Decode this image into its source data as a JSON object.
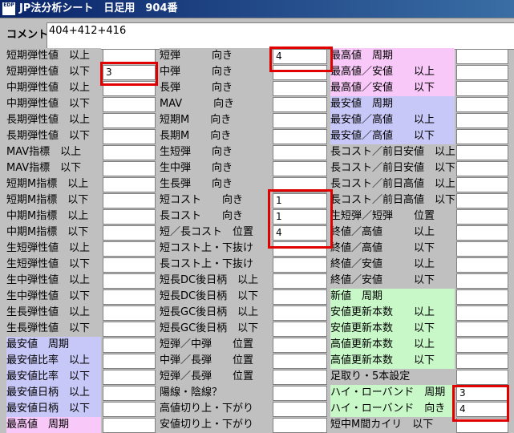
{
  "window": {
    "title": "JP法分析シート　日足用　904番",
    "icon_text": "EDP"
  },
  "comment": {
    "label": "コメント",
    "value": "404+412+416"
  },
  "col1": [
    {
      "label": "短期弾性値　以上",
      "bg": "#c0c0c0",
      "value": ""
    },
    {
      "label": "短期弾性値　以下",
      "bg": "#c0c0c0",
      "value": "3"
    },
    {
      "label": "中期弾性値　以上",
      "bg": "#c0c0c0",
      "value": ""
    },
    {
      "label": "中期弾性値　以下",
      "bg": "#c0c0c0",
      "value": ""
    },
    {
      "label": "長期弾性値　以上",
      "bg": "#c0c0c0",
      "value": ""
    },
    {
      "label": "長期弾性値　以下",
      "bg": "#c0c0c0",
      "value": ""
    },
    {
      "label": "MAV指標　以上",
      "bg": "#c0c0c0",
      "value": ""
    },
    {
      "label": "MAV指標　以下",
      "bg": "#c0c0c0",
      "value": ""
    },
    {
      "label": "短期M指標　以上",
      "bg": "#c0c0c0",
      "value": ""
    },
    {
      "label": "短期M指標　以下",
      "bg": "#c0c0c0",
      "value": ""
    },
    {
      "label": "中期M指標　以上",
      "bg": "#c0c0c0",
      "value": ""
    },
    {
      "label": "中期M指標　以下",
      "bg": "#c0c0c0",
      "value": ""
    },
    {
      "label": "生短弾性値　以上",
      "bg": "#c0c0c0",
      "value": ""
    },
    {
      "label": "生短弾性値　以下",
      "bg": "#c0c0c0",
      "value": ""
    },
    {
      "label": "生中弾性値　以上",
      "bg": "#c0c0c0",
      "value": ""
    },
    {
      "label": "生中弾性値　以下",
      "bg": "#c0c0c0",
      "value": ""
    },
    {
      "label": "生長弾性値　以上",
      "bg": "#c0c0c0",
      "value": ""
    },
    {
      "label": "生長弾性値　以下",
      "bg": "#c0c0c0",
      "value": ""
    },
    {
      "label": "最安値　周期",
      "bg": "#c8c8f8",
      "value": ""
    },
    {
      "label": "最安値比率　以上",
      "bg": "#c8c8f8",
      "value": ""
    },
    {
      "label": "最安値比率　以下",
      "bg": "#c8c8f8",
      "value": ""
    },
    {
      "label": "最安値日柄　以上",
      "bg": "#c8c8f8",
      "value": ""
    },
    {
      "label": "最安値日柄　以下",
      "bg": "#c8c8f8",
      "value": ""
    },
    {
      "label": "最高値　周期",
      "bg": "#f8c8f8",
      "value": ""
    }
  ],
  "col2": [
    {
      "label": "短弾　　　向き",
      "bg": "#c0c0c0",
      "value": "4"
    },
    {
      "label": "中弾　　　向き",
      "bg": "#c0c0c0",
      "value": ""
    },
    {
      "label": "長弾　　　向き",
      "bg": "#c0c0c0",
      "value": ""
    },
    {
      "label": "MAV　　　向き",
      "bg": "#c0c0c0",
      "value": ""
    },
    {
      "label": "短期M　　向き",
      "bg": "#c0c0c0",
      "value": ""
    },
    {
      "label": "長期M　　向き",
      "bg": "#c0c0c0",
      "value": ""
    },
    {
      "label": "生短弾　　向き",
      "bg": "#c0c0c0",
      "value": ""
    },
    {
      "label": "生中弾　　向き",
      "bg": "#c0c0c0",
      "value": ""
    },
    {
      "label": "生長弾　　向き",
      "bg": "#c0c0c0",
      "value": ""
    },
    {
      "label": "短コスト　　向き",
      "bg": "#c0c0c0",
      "value": "1"
    },
    {
      "label": "長コスト　　向き",
      "bg": "#c0c0c0",
      "value": "1"
    },
    {
      "label": "短／長コスト　位置",
      "bg": "#c0c0c0",
      "value": "4"
    },
    {
      "label": "短コスト上・下抜け",
      "bg": "#c0c0c0",
      "value": ""
    },
    {
      "label": "長コスト上・下抜け",
      "bg": "#c0c0c0",
      "value": ""
    },
    {
      "label": "短長DC後日柄　以上",
      "bg": "#c0c0c0",
      "value": ""
    },
    {
      "label": "短長DC後日柄　以下",
      "bg": "#c0c0c0",
      "value": ""
    },
    {
      "label": "短長GC後日柄　以上",
      "bg": "#c0c0c0",
      "value": ""
    },
    {
      "label": "短長GC後日柄　以下",
      "bg": "#c0c0c0",
      "value": ""
    },
    {
      "label": "短弾／中弾　　位置",
      "bg": "#c0c0c0",
      "value": ""
    },
    {
      "label": "中弾／長弾　　位置",
      "bg": "#c0c0c0",
      "value": ""
    },
    {
      "label": "短弾／長弾　　位置",
      "bg": "#c0c0c0",
      "value": ""
    },
    {
      "label": "陽線・陰線？",
      "bg": "#c0c0c0",
      "value": ""
    },
    {
      "label": "高値切り上・下がり",
      "bg": "#c0c0c0",
      "value": ""
    },
    {
      "label": "安値切り上・下がり",
      "bg": "#c0c0c0",
      "value": ""
    }
  ],
  "col3": [
    {
      "label": "最高値　周期",
      "bg": "#f8c8f8",
      "value": ""
    },
    {
      "label": "最高値／安値　　以上",
      "bg": "#f8c8f8",
      "value": ""
    },
    {
      "label": "最高値／安値　　以下",
      "bg": "#f8c8f8",
      "value": ""
    },
    {
      "label": "最安値　周期",
      "bg": "#c8c8f8",
      "value": ""
    },
    {
      "label": "最安値／高値　　以上",
      "bg": "#c8c8f8",
      "value": ""
    },
    {
      "label": "最安値／高値　　以下",
      "bg": "#c8c8f8",
      "value": ""
    },
    {
      "label": "長コスト／前日安値　以上",
      "bg": "#c0c0c0",
      "value": ""
    },
    {
      "label": "長コスト／前日安値　以下",
      "bg": "#c0c0c0",
      "value": ""
    },
    {
      "label": "長コスト／前日高値　以上",
      "bg": "#c0c0c0",
      "value": ""
    },
    {
      "label": "長コスト／前日高値　以下",
      "bg": "#c0c0c0",
      "value": ""
    },
    {
      "label": "生短弾／短弾　　位置",
      "bg": "#c0c0c0",
      "value": ""
    },
    {
      "label": "終値／高値　　　以上",
      "bg": "#c0c0c0",
      "value": ""
    },
    {
      "label": "終値／高値　　　以下",
      "bg": "#c0c0c0",
      "value": ""
    },
    {
      "label": "終値／安値　　　以上",
      "bg": "#c0c0c0",
      "value": ""
    },
    {
      "label": "終値／安値　　　以下",
      "bg": "#c0c0c0",
      "value": ""
    },
    {
      "label": "新値　周期",
      "bg": "#c8f8c8",
      "value": ""
    },
    {
      "label": "安値更新本数　　以上",
      "bg": "#c8f8c8",
      "value": ""
    },
    {
      "label": "安値更新本数　　以下",
      "bg": "#c8f8c8",
      "value": ""
    },
    {
      "label": "高値更新本数　　以上",
      "bg": "#c8f8c8",
      "value": ""
    },
    {
      "label": "高値更新本数　　以下",
      "bg": "#c8f8c8",
      "value": ""
    },
    {
      "label": "足取り・5本設定",
      "bg": "#c0c0c0",
      "value": ""
    },
    {
      "label": "ハイ・ローバンド　周期",
      "bg": "#c8f8c8",
      "value": "3"
    },
    {
      "label": "ハイ・ローバンド　向き",
      "bg": "#c8f8c8",
      "value": "4"
    },
    {
      "label": "短中M間カイリ　以下",
      "bg": "#c0c0c0",
      "value": ""
    }
  ]
}
